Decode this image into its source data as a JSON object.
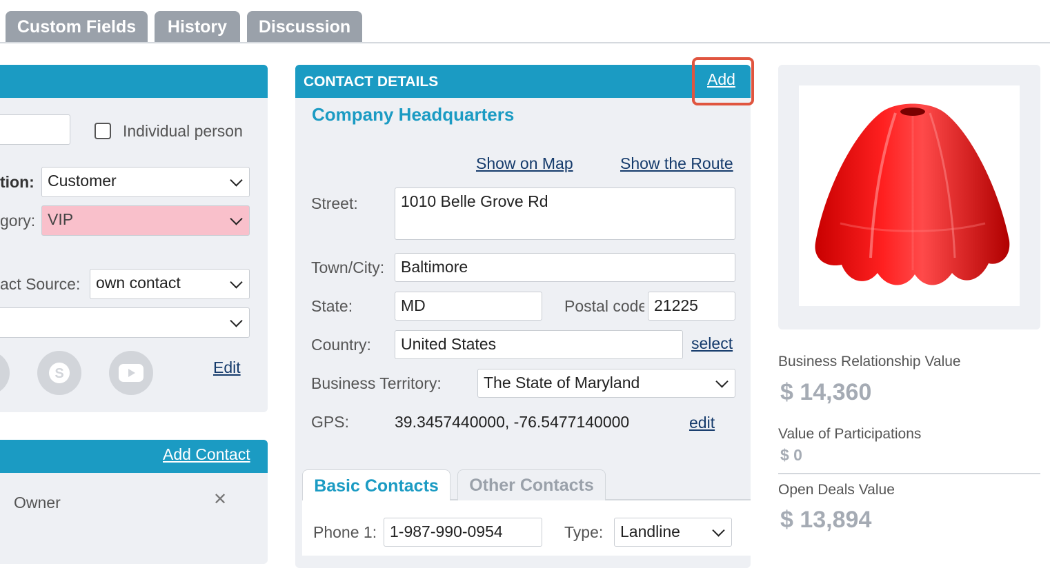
{
  "tabs": [
    "Custom Fields",
    "History",
    "Discussion"
  ],
  "left_panel": {
    "individual_person_label": "Individual person",
    "relation_label": "tion:",
    "relation_value": "Customer",
    "category_label": "gory:",
    "category_value": "VIP",
    "contact_source_label": "act Source:",
    "contact_source_value": "own contact",
    "blank_select_value": "",
    "edit_link": "Edit"
  },
  "contacts_panel": {
    "add_contact_link": "Add Contact",
    "role": "Owner",
    "remove_symbol": "✕"
  },
  "contact_details": {
    "header_title": "CONTACT DETAILS",
    "add_link": "Add",
    "location_title": "Company Headquarters",
    "show_on_map": "Show on Map",
    "show_route": "Show the Route",
    "street_label": "Street:",
    "street_value": "1010 Belle Grove Rd",
    "city_label": "Town/City:",
    "city_value": "Baltimore",
    "state_label": "State:",
    "state_value": "MD",
    "postal_label": "Postal code",
    "postal_value": "21225",
    "country_label": "Country:",
    "country_value": "United States",
    "select_link": "select",
    "territory_label": "Business Territory:",
    "territory_value": "The State of Maryland",
    "gps_label": "GPS:",
    "gps_value": "39.3457440000, -76.5477140000",
    "gps_edit_link": "edit",
    "subtabs": [
      "Basic Contacts",
      "Other Contacts"
    ],
    "phone_label": "Phone 1:",
    "phone_value": "1-987-990-0954",
    "type_label": "Type:",
    "type_value": "Landline"
  },
  "stats": {
    "business_relationship_label": "Business Relationship Value",
    "business_relationship_value": "$ 14,360",
    "participations_label": "Value of Participations",
    "participations_value": "$ 0",
    "open_deals_label": "Open Deals Value",
    "open_deals_value": "$ 13,894"
  },
  "colors": {
    "header_blue": "#1b9bc3",
    "tab_gray": "#9aa1aa",
    "highlight_red": "#e0553f",
    "vip_pink": "#f9c0cb"
  }
}
